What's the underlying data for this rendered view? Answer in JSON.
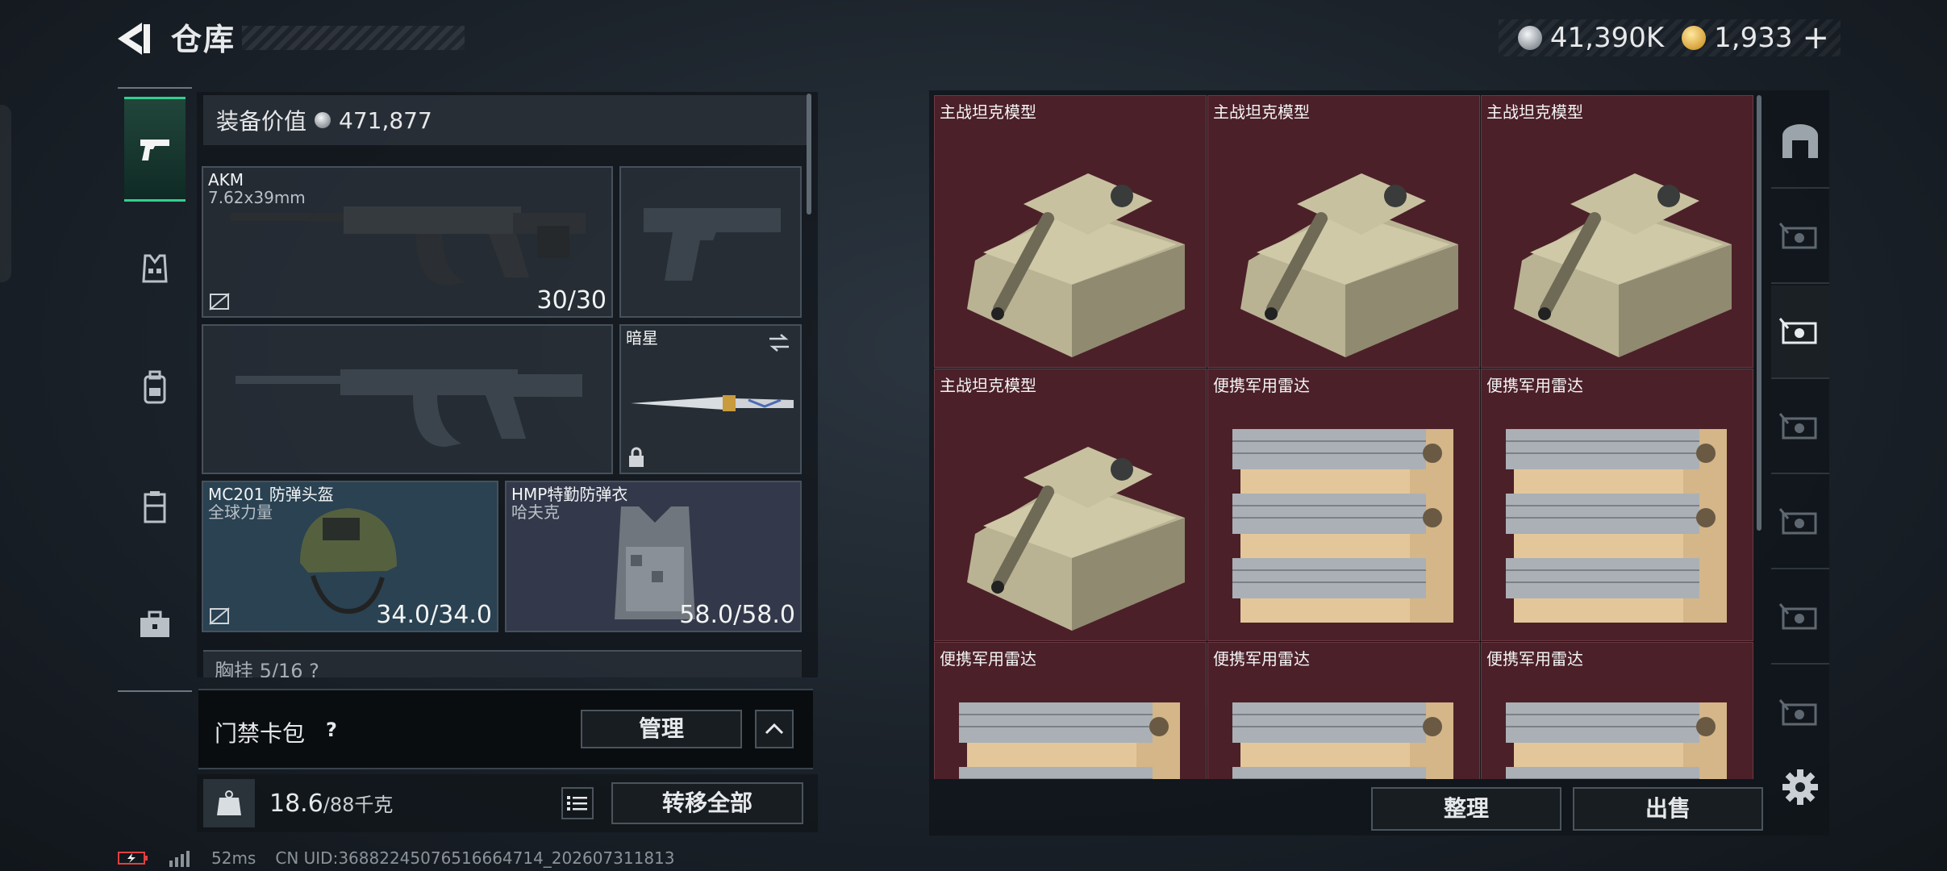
{
  "header": {
    "title": "仓库",
    "currency": [
      {
        "icon": "silver-coin-icon",
        "value": "41,390K"
      },
      {
        "icon": "gold-coin-icon",
        "value": "1,933"
      }
    ],
    "plus": "+"
  },
  "rail": [
    {
      "icon": "pistol-icon",
      "active": true
    },
    {
      "icon": "vest-icon",
      "active": false
    },
    {
      "icon": "backpack-icon",
      "active": false
    },
    {
      "icon": "chest-rig-icon",
      "active": false
    },
    {
      "icon": "briefcase-icon",
      "active": false
    }
  ],
  "loadout": {
    "value_label": "装备价值",
    "value": "471,877",
    "primary": {
      "name": "AKM",
      "caliber": "7.62x39mm",
      "ammo": "30/30"
    },
    "melee": {
      "name": "暗星"
    },
    "helmet": {
      "name": "MC201 防弹头盔",
      "brand": "全球力量",
      "durability": "34.0/34.0"
    },
    "armor": {
      "name": "HMP特勤防弹衣",
      "brand": "哈夫克",
      "durability": "58.0/58.0"
    },
    "chest_rig_label": "胸挂 5/16 ?"
  },
  "card_wallet": {
    "label": "门禁卡包",
    "help": "?",
    "manage": "管理"
  },
  "weight": {
    "current": "18.6",
    "max": "/88千克",
    "transfer": "转移全部"
  },
  "storage": {
    "items": [
      {
        "name": "主战坦克模型",
        "type": "tank"
      },
      {
        "name": "主战坦克模型",
        "type": "tank"
      },
      {
        "name": "主战坦克模型",
        "type": "tank"
      },
      {
        "name": "主战坦克模型",
        "type": "tank"
      },
      {
        "name": "便携军用雷达",
        "type": "radar"
      },
      {
        "name": "便携军用雷达",
        "type": "radar"
      },
      {
        "name": "便携军用雷达",
        "type": "radar"
      },
      {
        "name": "便携军用雷达",
        "type": "radar"
      },
      {
        "name": "便携军用雷达",
        "type": "radar"
      }
    ],
    "sort": "整理",
    "sell": "出售",
    "item_bg": "#4c2029"
  },
  "status": {
    "ping": "52ms",
    "uid": "CN UID:36882245076516664714_202607311813"
  }
}
